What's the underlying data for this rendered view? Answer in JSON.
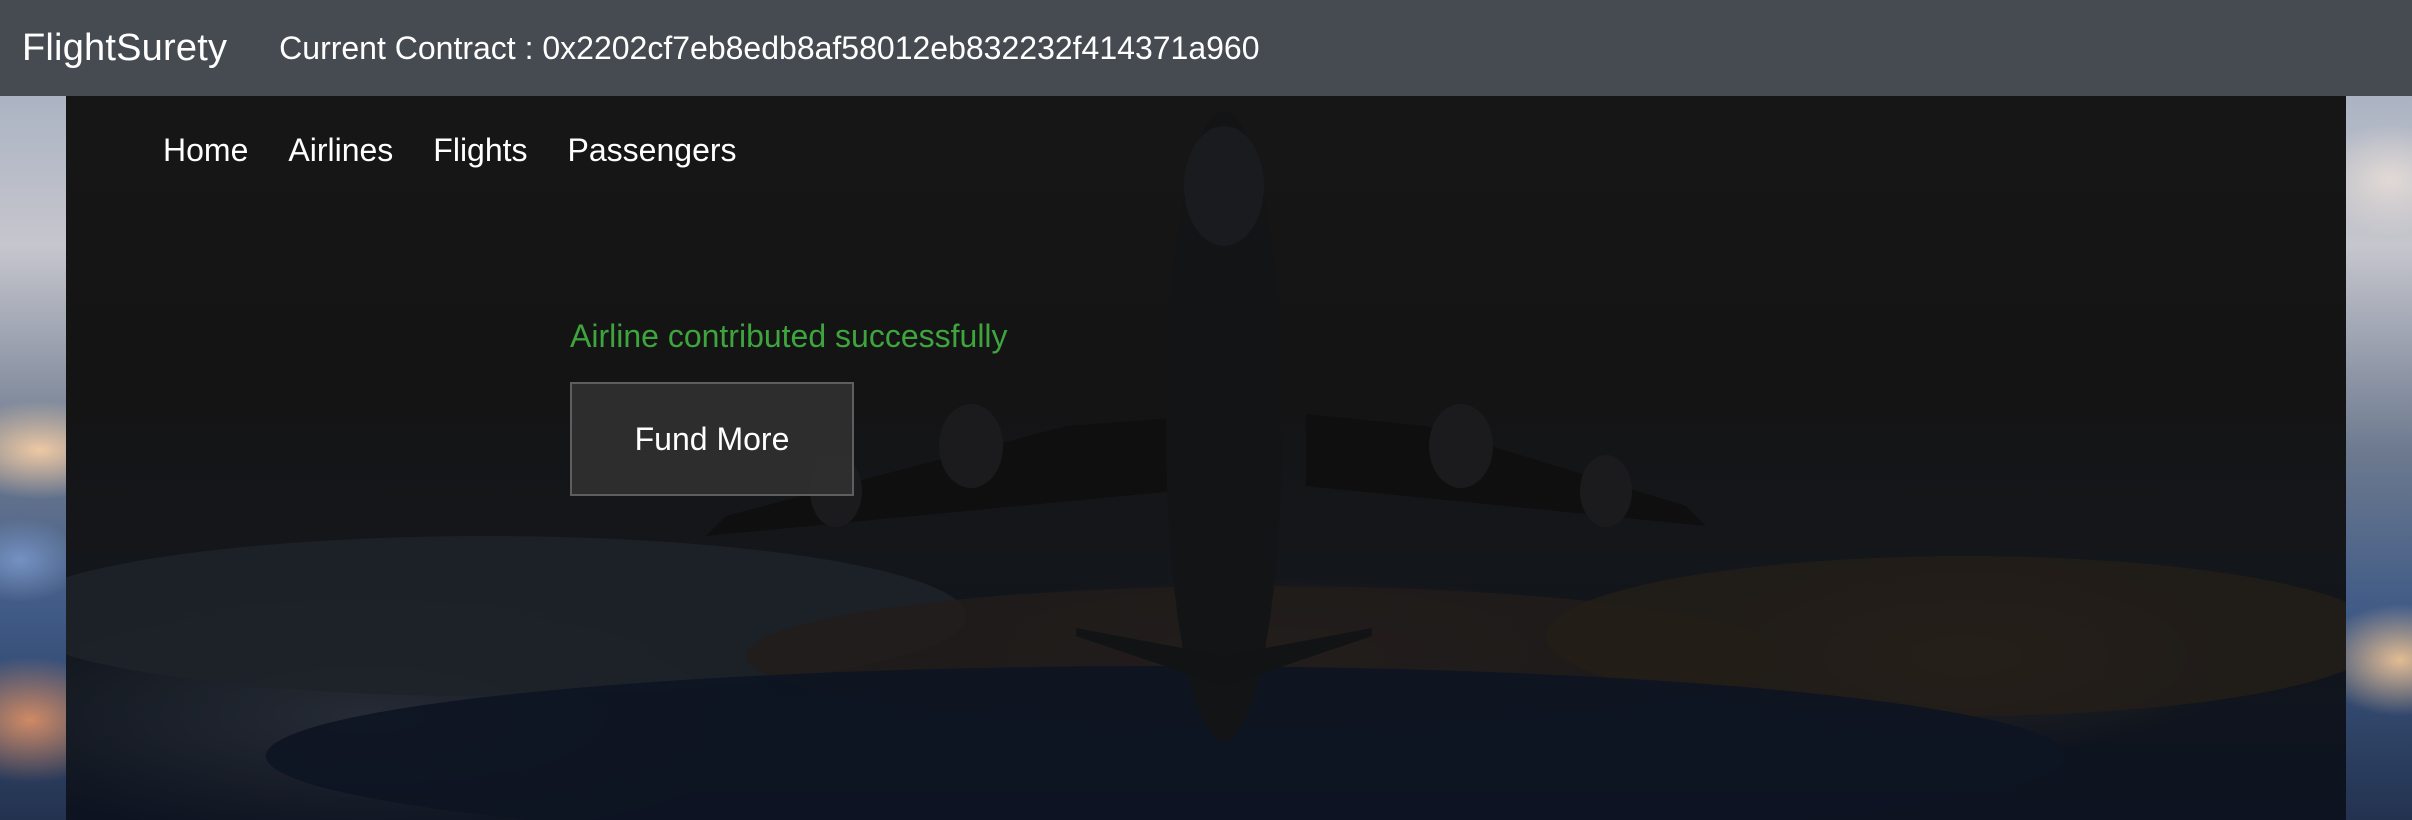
{
  "header": {
    "brand": "FlightSurety",
    "contract_text": "Current Contract : 0x2202cf7eb8edb8af58012eb832232f414371a960"
  },
  "nav": {
    "items": [
      "Home",
      "Airlines",
      "Flights",
      "Passengers"
    ]
  },
  "main": {
    "status_message": "Airline contributed successfully",
    "status_color": "#3ea43e",
    "fund_button_label": "Fund More"
  },
  "colors": {
    "topbar": "#464b51",
    "panel": "#141414"
  }
}
